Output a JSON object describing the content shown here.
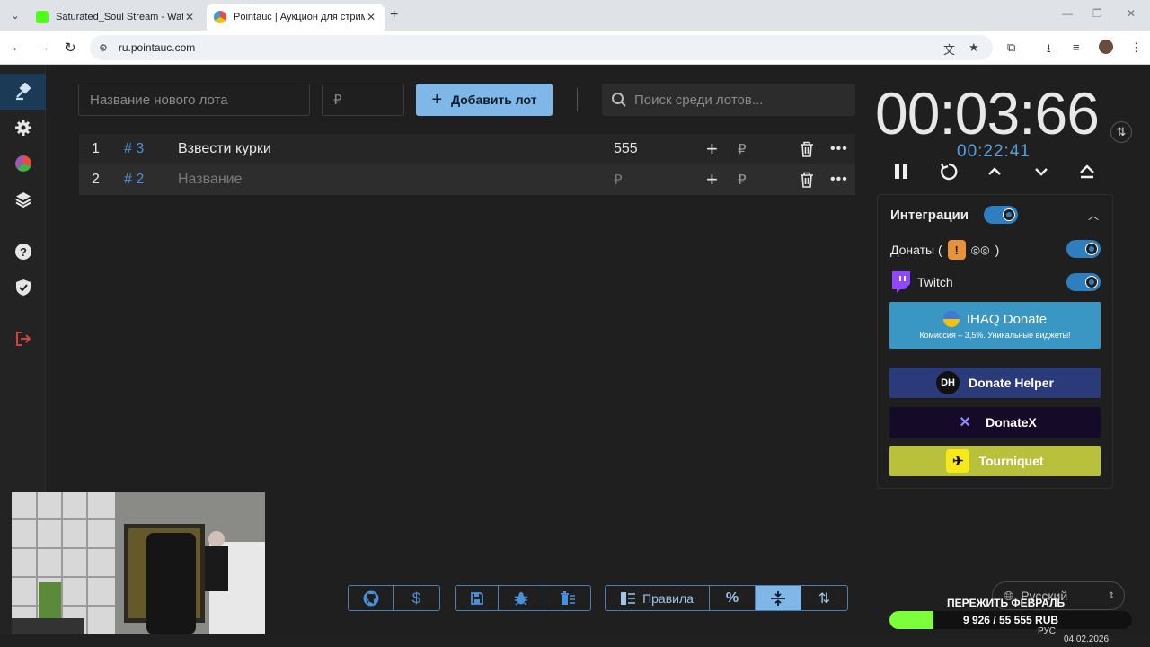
{
  "browser": {
    "tabs": [
      {
        "title": "Saturated_Soul Stream - Watch",
        "active": false
      },
      {
        "title": "Pointauc | Аукцион для стриме",
        "active": true
      }
    ],
    "url": "ru.pointauc.com"
  },
  "sidebar": {
    "items": [
      "auction-icon",
      "settings-icon",
      "wheel-icon",
      "layers-icon",
      "help-icon",
      "shield-check-icon",
      "logout-icon"
    ]
  },
  "form": {
    "lot_name_placeholder": "Название нового лота",
    "amount_placeholder": "₽",
    "add_button": "Добавить лот",
    "search_placeholder": "Поиск среди лотов..."
  },
  "lots": [
    {
      "index": "1",
      "id": "# 3",
      "name": "Взвести курки",
      "amount": "555",
      "currency": "₽"
    },
    {
      "index": "2",
      "id": "# 2",
      "name": "Название",
      "amount": "₽",
      "currency": "₽"
    }
  ],
  "timer": {
    "main": "00:03:66",
    "secondary": "00:22:41"
  },
  "integrations": {
    "title": "Интеграции",
    "enabled": true,
    "donations_label": "Донаты (",
    "donations_suffix": ")",
    "twitch_label": "Twitch",
    "ihaq": {
      "title": "IHAQ Donate",
      "subtitle": "Комиссия – 3,5%. Уникальные виджеты!"
    },
    "donate_helper": "Donate Helper",
    "donatex": "DonateX",
    "tourniquet": "Tourniquet"
  },
  "toolbar": {
    "rules_label": "Правила"
  },
  "language": "Русский",
  "goal": {
    "title": "ПЕРЕЖИТЬ ФЕВРАЛЬ",
    "progress_text": "9 926 / 55 555 RUB",
    "progress_fraction": 0.18
  },
  "system": {
    "date": "04.02.2026",
    "lang": "РУС"
  }
}
